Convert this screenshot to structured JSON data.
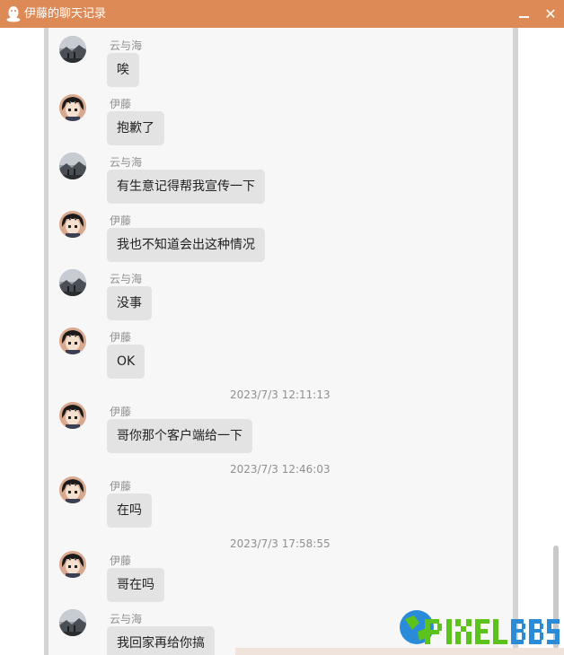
{
  "window": {
    "title": "伊藤的聊天记录",
    "minimize_icon": "minimize-icon",
    "close_glyph": "✕"
  },
  "colors": {
    "titlebar": "#dd8a57",
    "bubble": "#e3e3e3",
    "chat_bg": "#f7f7f7",
    "watermark_green": "#5cc21c",
    "watermark_blue": "#2a8bd9"
  },
  "messages": [
    {
      "type": "message",
      "sender": "云与海",
      "text": "唉",
      "avatar": "scenery-avatar"
    },
    {
      "type": "message",
      "sender": "伊藤",
      "text": "抱歉了",
      "avatar": "anime-avatar"
    },
    {
      "type": "message",
      "sender": "云与海",
      "text": "有生意记得帮我宣传一下",
      "avatar": "scenery-avatar"
    },
    {
      "type": "message",
      "sender": "伊藤",
      "text": "我也不知道会出这种情况",
      "avatar": "anime-avatar"
    },
    {
      "type": "message",
      "sender": "云与海",
      "text": "没事",
      "avatar": "scenery-avatar"
    },
    {
      "type": "message",
      "sender": "伊藤",
      "text": "OK",
      "avatar": "anime-avatar"
    },
    {
      "type": "timestamp",
      "text": "2023/7/3 12:11:13"
    },
    {
      "type": "message",
      "sender": "伊藤",
      "text": "哥你那个客户端给一下",
      "avatar": "anime-avatar"
    },
    {
      "type": "timestamp",
      "text": "2023/7/3 12:46:03"
    },
    {
      "type": "message",
      "sender": "伊藤",
      "text": "在吗",
      "avatar": "anime-avatar"
    },
    {
      "type": "timestamp",
      "text": "2023/7/3 17:58:55"
    },
    {
      "type": "message",
      "sender": "伊藤",
      "text": "哥在吗",
      "avatar": "anime-avatar"
    },
    {
      "type": "message",
      "sender": "云与海",
      "text": "我回家再给你搞",
      "avatar": "scenery-avatar"
    }
  ],
  "watermark": {
    "logo": "PIXELBBS"
  }
}
